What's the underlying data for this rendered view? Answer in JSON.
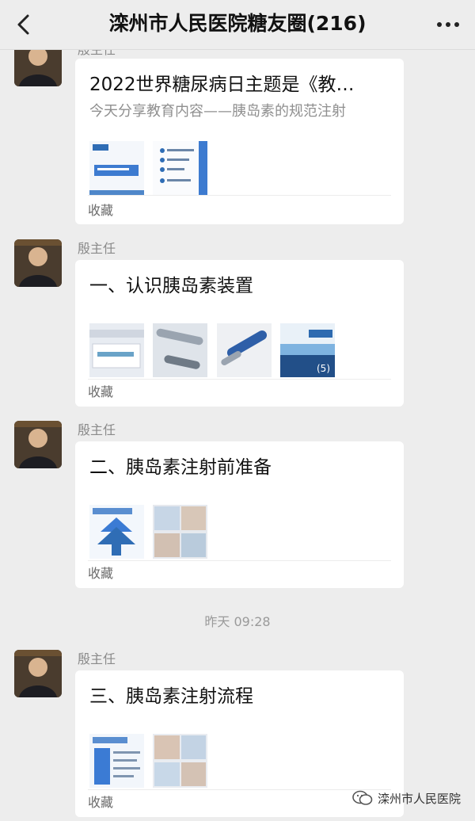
{
  "header": {
    "title": "滦州市人民医院糖友圈(216)",
    "back_icon": "chevron-left-icon",
    "more_icon": "more-dots-icon"
  },
  "messages": [
    {
      "sender": "殷主任",
      "title": "2022世界糖尿病日主题是《教…",
      "subtitle": "今天分享教育内容——胰岛素的规范注射",
      "fav_label": "收藏",
      "thumbnails": 2
    },
    {
      "sender": "殷主任",
      "title": "一、认识胰岛素装置",
      "fav_label": "收藏",
      "thumbnails": 4,
      "more_count": "(5)"
    },
    {
      "sender": "殷主任",
      "title": "二、胰岛素注射前准备",
      "fav_label": "收藏",
      "thumbnails": 2
    },
    {
      "sender": "殷主任",
      "title": "三、胰岛素注射流程",
      "fav_label": "收藏",
      "thumbnails": 2
    }
  ],
  "timestamp": "昨天 09:28",
  "watermark": {
    "text": "滦州市人民医院",
    "icon": "wechat-official-icon"
  }
}
